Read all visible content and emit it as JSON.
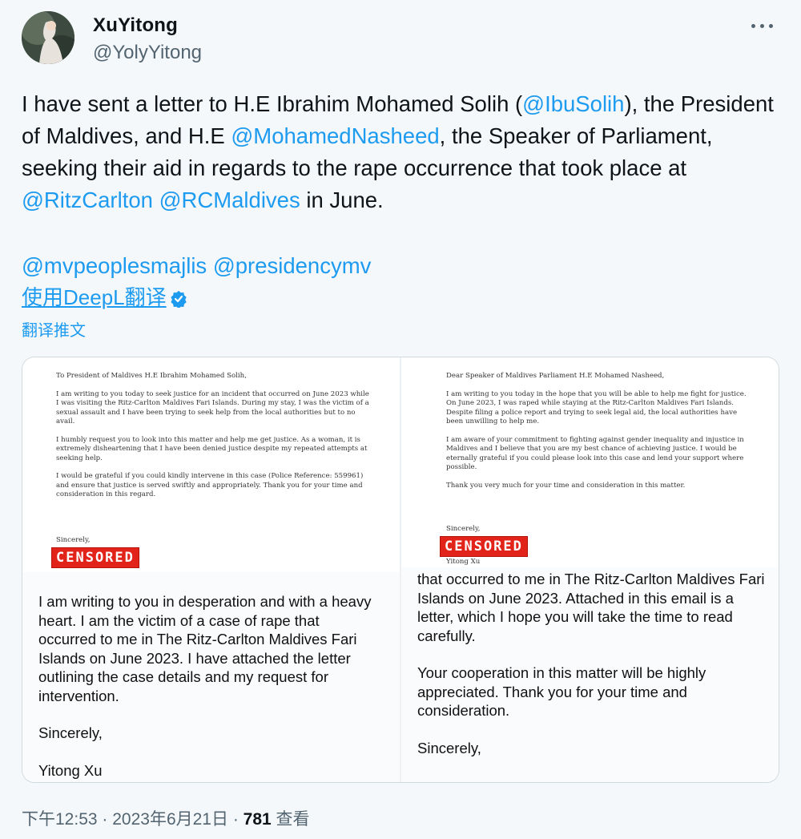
{
  "header": {
    "display_name": "XuYitong",
    "handle": "@YolyYitong"
  },
  "tweet": {
    "t1": "I have sent a letter to H.E Ibrahim Mohamed Solih (",
    "m1": "@IbuSolih",
    "t2": "), the President of Maldives, and H.E ",
    "m2": "@MohamedNasheed",
    "t3": ", the Speaker of Parliament, seeking their aid in regards to the rape occurrence that took place at ",
    "m3": "@RitzCarlton",
    "t4": " ",
    "m4": "@RCMaldives",
    "t5": " in June.",
    "tags": "@mvpeoplesmajlis @presidencymv",
    "deepl_link": "使用DeepL翻译",
    "translate_link": "翻译推文"
  },
  "left_letter": {
    "greeting": "To President of Maldives H.E Ibrahim Mohamed Solih,",
    "p1": "I am writing to you today to seek justice for an incident that occurred on June 2023 while I was visiting the Ritz-Carlton Maldives Fari Islands. During my stay, I was the victim of a sexual assault and I have been trying to seek help from the local authorities but to no avail.",
    "p2": "I humbly request you to look into this matter and help me get justice. As a woman, it is extremely disheartening that I have been denied justice despite my repeated attempts at seeking help.",
    "p3": "I would be grateful if you could kindly intervene in this case (Police Reference: 559961) and ensure that justice is served swiftly and appropriately. Thank you for your time and consideration in this regard.",
    "closing": "Sincerely,",
    "stamp": "CENSORED"
  },
  "right_letter": {
    "greeting": "Dear Speaker of Maldives Parliament H.E Mohamed Nasheed,",
    "p1": "I am writing to you today in the hope that you will be able to help me fight for justice. On June 2023, I was raped while staying at the Ritz-Carlton Maldives Fari Islands. Despite filing a police report and trying to seek legal aid, the local authorities have been unwilling to help me.",
    "p2": "I am aware of your commitment to fighting against gender inequality and injustice in Maldives and I believe that you are my best chance of achieving justice. I would be eternally grateful if you could please look into this case and lend your support where possible.",
    "p3": "Thank you very much for your time and consideration in this matter.",
    "closing": "Sincerely,",
    "stamp": "CENSORED",
    "name": "Yitong Xu"
  },
  "left_email": {
    "p1": "I am writing to you in desperation and with a heavy heart. I am the victim of a case of rape that occurred to me in The Ritz-Carlton Maldives Fari Islands on June 2023. I have attached the letter outlining the case details and my request for intervention.",
    "closing": "Sincerely,",
    "name": "Yitong Xu"
  },
  "right_email": {
    "p1": "that occurred to me in The Ritz-Carlton Maldives Fari Islands on June 2023. Attached in this email is a letter, which I hope you will take the time to read carefully.",
    "p2": "Your cooperation in this matter will be highly appreciated. Thank you for your time and consideration.",
    "closing": "Sincerely,"
  },
  "footer": {
    "time": "下午12:53",
    "sep1": " · ",
    "date": "2023年6月21日",
    "sep2": " · ",
    "views_count": "781",
    "views_label": " 查看"
  },
  "colors": {
    "link": "#1d9bf0",
    "censored": "#e2231a",
    "muted": "#536471"
  }
}
